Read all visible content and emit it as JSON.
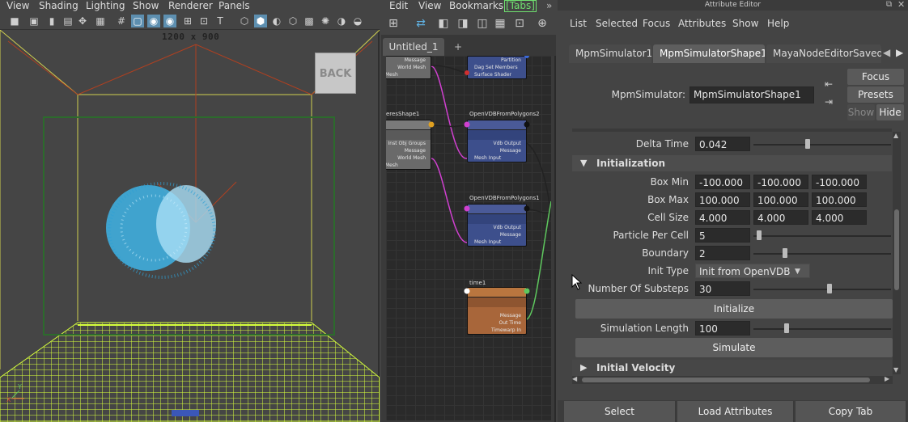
{
  "viewport": {
    "menu": [
      "View",
      "Shading",
      "Lighting",
      "Show",
      "Renderer",
      "Panels"
    ],
    "resolution_text": "1200 x 900",
    "back_label": "BACK",
    "axis_y": "Y",
    "axis_x": "X",
    "icons": [
      "camera-icon",
      "camera-attr-icon",
      "bookmark-icon",
      "image-plane-icon",
      "transform-icon",
      "film-gate-icon",
      "resolution-gate-icon",
      "gate-mask-icon",
      "field-chart-icon",
      "safe-action-icon",
      "safe-title-icon",
      "wireframe-icon",
      "smooth-shade-icon",
      "xray-icon",
      "isolate-icon",
      "texture-icon",
      "lighting-icon",
      "shadow-icon",
      "ao-icon",
      "aa-icon"
    ],
    "colors": {
      "particles": "#3fb4e6",
      "grid": "#d6ff3c",
      "bounds": "#2c6b2c",
      "box": "#d0d050"
    }
  },
  "node_editor": {
    "menu": [
      "Edit",
      "View",
      "Bookmarks"
    ],
    "tabs_badge": "[Tabs]",
    "tab_name": "Untitled_1",
    "tab_add": "+",
    "nodes": [
      {
        "title": "",
        "rows": [
          "Message",
          "World Mesh",
          "Mesh"
        ]
      },
      {
        "title": "",
        "rows": [
          "Partition",
          "Dag Set Members",
          "Surface Shader"
        ]
      },
      {
        "title": "eresShape1",
        "rows": [
          "Inst Obj Groups",
          "Message",
          "World Mesh",
          "Mesh"
        ]
      },
      {
        "title": "OpenVDBFromPolygons2",
        "rows": [
          "Vdb Output",
          "Message",
          "Mesh Input"
        ]
      },
      {
        "title": "OpenVDBFromPolygons1",
        "rows": [
          "Vdb Output",
          "Message",
          "Mesh Input"
        ]
      },
      {
        "title": "time1",
        "rows": [
          "Message",
          "Out Time",
          "Timewarp In"
        ]
      }
    ]
  },
  "attr_editor": {
    "title": "Attribute Editor",
    "menu": [
      "List",
      "Selected",
      "Focus",
      "Attributes",
      "Show",
      "Help"
    ],
    "tabs": [
      "MpmSimulator1",
      "MpmSimulatorShape1",
      "MayaNodeEditorSavedTab"
    ],
    "node_label": "MpmSimulator:",
    "node_value": "MpmSimulatorShape1",
    "focus_btn": "Focus",
    "presets_btn": "Presets",
    "show_btn": "Show",
    "hide_btn": "Hide",
    "delta_time": {
      "label": "Delta Time",
      "value": "0.042"
    },
    "init_section": "Initialization",
    "box_min": {
      "label": "Box Min",
      "values": [
        "-100.000",
        "-100.000",
        "-100.000"
      ]
    },
    "box_max": {
      "label": "Box Max",
      "values": [
        "100.000",
        "100.000",
        "100.000"
      ]
    },
    "cell_size": {
      "label": "Cell Size",
      "values": [
        "4.000",
        "4.000",
        "4.000"
      ]
    },
    "particle_per_cell": {
      "label": "Particle Per Cell",
      "value": "5"
    },
    "boundary": {
      "label": "Boundary",
      "value": "2"
    },
    "init_type": {
      "label": "Init Type",
      "value": "Init from OpenVDB"
    },
    "substeps": {
      "label": "Number Of Substeps",
      "value": "30"
    },
    "initialize_btn": "Initialize",
    "sim_length": {
      "label": "Simulation Length",
      "value": "100"
    },
    "simulate_btn": "Simulate",
    "velocity_section": "Initial Velocity",
    "bottom": [
      "Select",
      "Load Attributes",
      "Copy Tab"
    ]
  }
}
